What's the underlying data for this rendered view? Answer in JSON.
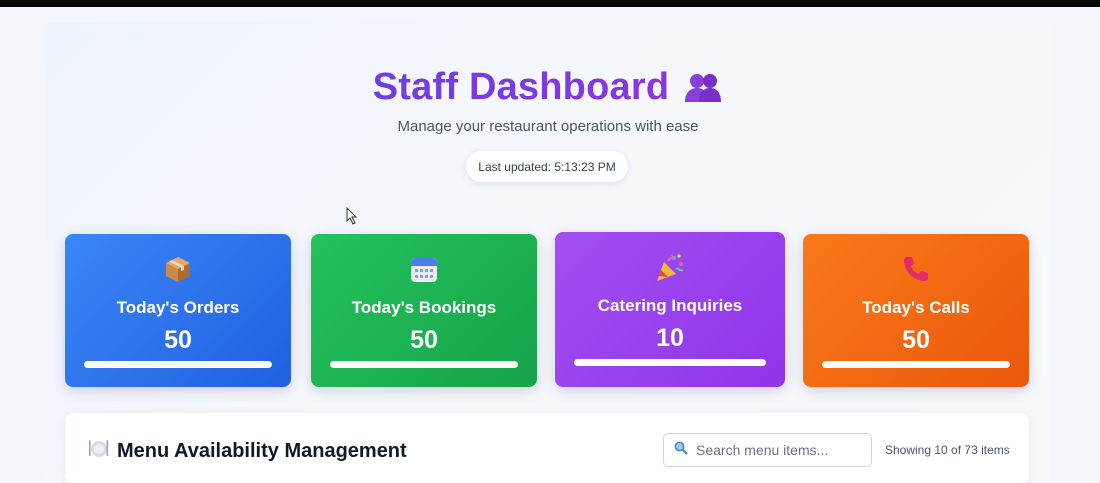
{
  "header": {
    "title": "Staff Dashboard",
    "title_icon": "people-icon",
    "subtitle": "Manage your restaurant operations with ease",
    "last_updated": "Last updated: 5:13:23 PM"
  },
  "stats": [
    {
      "label": "Today's Orders",
      "value": "50",
      "icon": "package-icon",
      "progress": 1.0,
      "color": "#2563eb"
    },
    {
      "label": "Today's Bookings",
      "value": "50",
      "icon": "calendar-icon",
      "progress": 1.0,
      "color": "#16a34a"
    },
    {
      "label": "Catering Inquiries",
      "value": "10",
      "icon": "party-popper-icon",
      "progress": 1.0,
      "color": "#9333ea"
    },
    {
      "label": "Today's Calls",
      "value": "50",
      "icon": "phone-icon",
      "progress": 1.0,
      "color": "#ea580c"
    }
  ],
  "menu": {
    "title": "Menu Availability Management",
    "title_icon": "plate-icon",
    "search_placeholder": "Search menu items...",
    "showing": "Showing 10 of 73 items"
  }
}
